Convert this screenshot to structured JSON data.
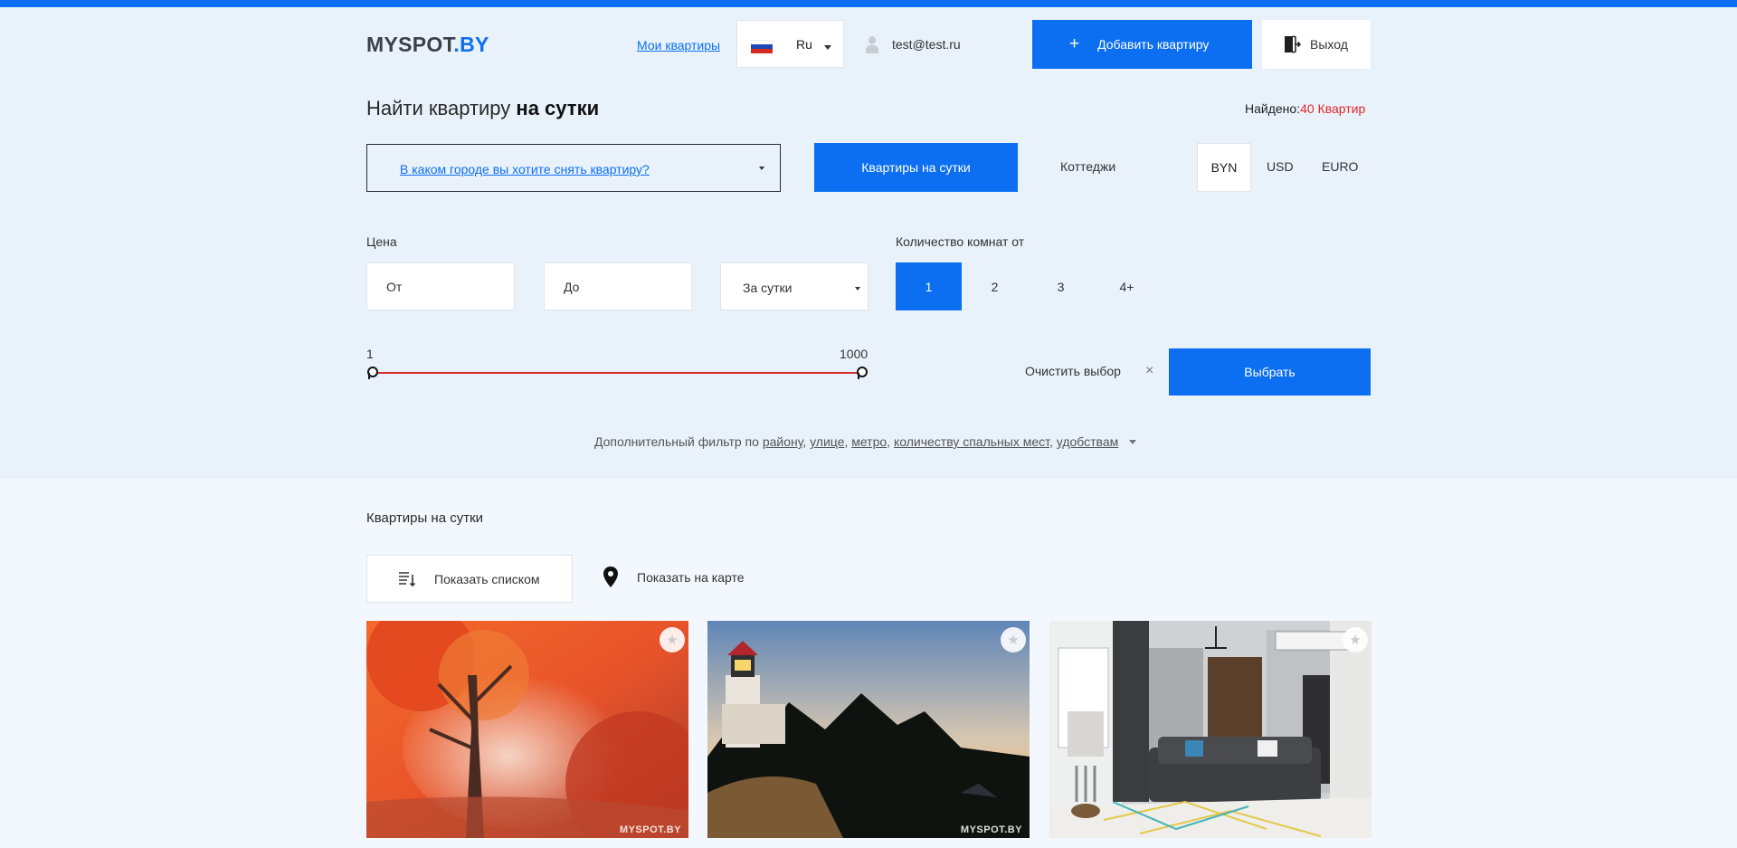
{
  "brand": {
    "logo_main": "MYSPOT",
    "logo_tld": ".BY"
  },
  "header": {
    "my_apartments": "Мои квартиры",
    "language": "Ru",
    "user_email": "test@test.ru",
    "add_apartment": "Добавить квартиру",
    "add_icon": "+",
    "logout": "Выход"
  },
  "search": {
    "title_regular": "Найти квартиру ",
    "title_bold": "на сутки",
    "found_label": "Найдено:",
    "found_count": "40 Квартир",
    "city_placeholder": "В каком городе вы хотите снять квартиру?",
    "tabs": [
      "Квартиры на сутки",
      "Коттеджи"
    ],
    "currencies": [
      "BYN",
      "USD",
      "EURO"
    ],
    "selected_currency": "BYN",
    "price_label": "Цена",
    "price_from_placeholder": "От",
    "price_to_placeholder": "До",
    "period": "За сутки",
    "rooms_label": "Количество комнат от",
    "rooms": [
      "1",
      "2",
      "3",
      "4+"
    ],
    "selected_room": "1",
    "range_min": "1",
    "range_max": "1000",
    "clear": "Очистить выбор",
    "clear_icon": "×",
    "submit": "Выбрать"
  },
  "extra_filter": {
    "prefix": "Дополнительный фильтр по ",
    "links": [
      "району",
      "улице",
      "метро",
      "количеству спальных мест",
      "удобствам"
    ]
  },
  "listing": {
    "title": "Квартиры на сутки",
    "show_list": "Показать списком",
    "show_map": "Показать на карте",
    "watermark": "MYSPOT.BY",
    "fav_icon": "★"
  },
  "colors": {
    "accent": "#0c6ff2",
    "range_track": "#d62b2b",
    "found_count": "#e5262a"
  },
  "icons": [
    "flag-ru-icon",
    "chevron-down-icon",
    "user-icon",
    "plus-icon",
    "logout-icon",
    "close-icon",
    "list-sort-icon",
    "map-pin-icon",
    "star-icon"
  ]
}
